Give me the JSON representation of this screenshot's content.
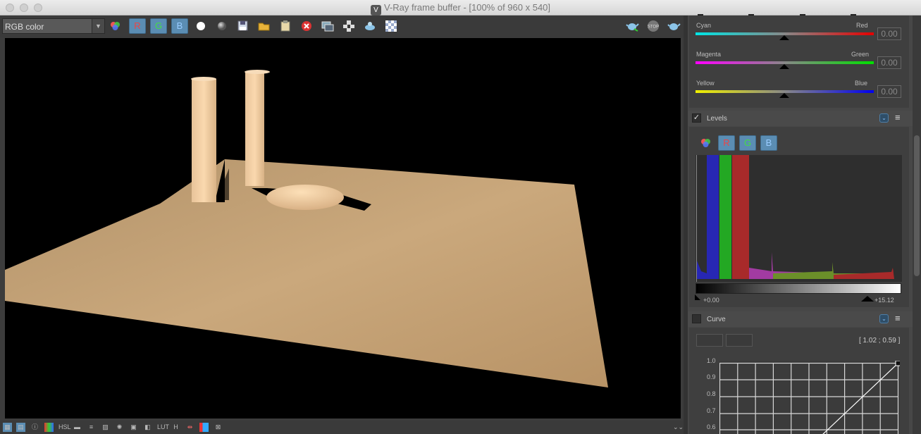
{
  "window": {
    "title": "V-Ray frame buffer - [100% of 960 x 540]"
  },
  "toolbar": {
    "channel_select": "RGB color",
    "r": "R",
    "g": "G",
    "b": "B",
    "icons": [
      "color-circles-icon",
      "red-channel",
      "green-channel",
      "blue-channel",
      "white-sphere-icon",
      "grey-sphere-icon",
      "save-icon",
      "open-folder-icon",
      "clipboard-icon",
      "clear-icon",
      "duplicate-icon",
      "track-mouse-icon",
      "render-region-icon",
      "checker-icon"
    ],
    "right_icons": [
      "render-teapot-icon",
      "stop-icon",
      "interactive-teapot-icon"
    ],
    "stop_label": "STOP"
  },
  "status": {
    "overflow": "⌄⌄",
    "h_label": "H"
  },
  "color_balance": {
    "rows": [
      {
        "left": "Cyan",
        "right": "Red",
        "value": "0.00",
        "from": "#00e5e5",
        "to": "#e50000"
      },
      {
        "left": "Magenta",
        "right": "Green",
        "value": "0.00",
        "from": "#ff00ff",
        "to": "#00e000"
      },
      {
        "left": "Yellow",
        "right": "Blue",
        "value": "0.00",
        "from": "#f0f000",
        "to": "#0000f0"
      }
    ]
  },
  "levels": {
    "title": "Levels",
    "enabled": true,
    "r": "R",
    "g": "G",
    "b": "B",
    "min_label": "+0.00",
    "max_label": "+15.12"
  },
  "curve": {
    "title": "Curve",
    "enabled": false,
    "coord": "[ 1.02 ; 0.59 ]",
    "y_ticks": [
      "1.0",
      "0.9",
      "0.8",
      "0.7",
      "0.6"
    ]
  },
  "colors": {
    "accent": "#5b8db3",
    "viewport_bg": "#000000",
    "floor": "#c4a47c",
    "object": "#f3cfa2"
  }
}
